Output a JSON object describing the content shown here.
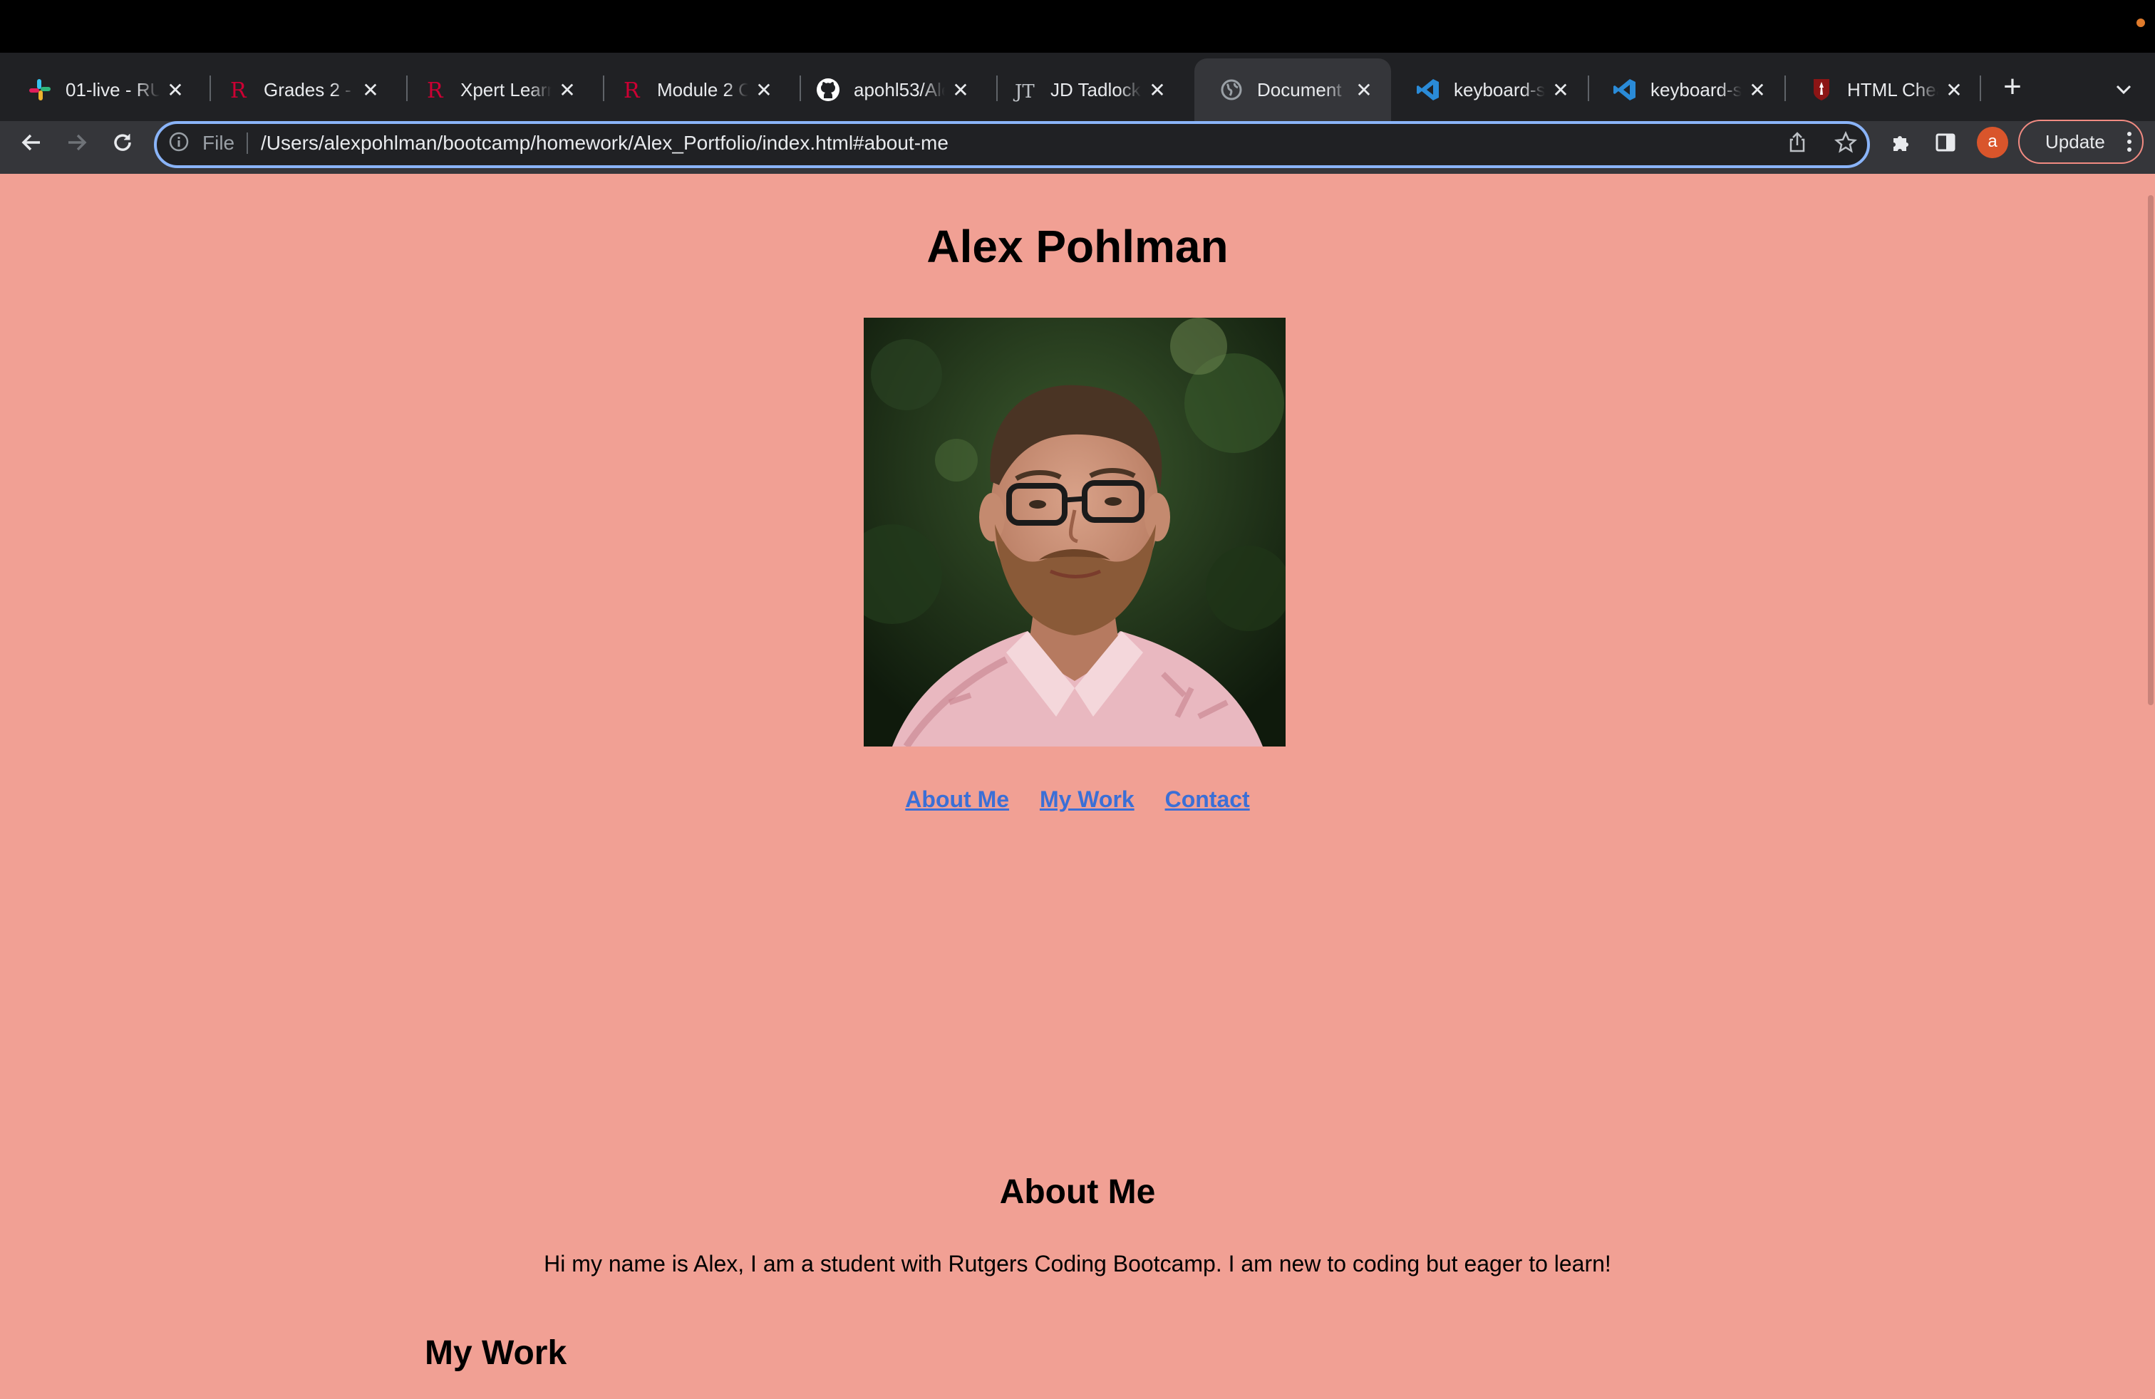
{
  "browser": {
    "tabs": [
      {
        "title": "01-live - RUT",
        "icon": "slack-icon",
        "active": false
      },
      {
        "title": "Grades 2 - B",
        "icon": "rutgers-icon",
        "active": false
      },
      {
        "title": "Xpert Learnin",
        "icon": "rutgers-icon",
        "active": false
      },
      {
        "title": "Module 2 Ch",
        "icon": "rutgers-icon",
        "active": false
      },
      {
        "title": "apohl53/Alex",
        "icon": "github-icon",
        "active": false
      },
      {
        "title": "JD Tadlock | ",
        "icon": "jt-icon",
        "active": false
      },
      {
        "title": "Document",
        "icon": "globe-icon",
        "active": true
      },
      {
        "title": "keyboard-sh",
        "icon": "vscode-icon",
        "active": false
      },
      {
        "title": "keyboard-sh",
        "icon": "vscode-icon",
        "active": false
      },
      {
        "title": "HTML Cheat",
        "icon": "stanford-icon",
        "active": false
      }
    ],
    "address": {
      "scheme_label": "File",
      "url": "/Users/alexpohlman/bootcamp/homework/Alex_Portfolio/index.html#about-me"
    },
    "avatar_letter": "a",
    "update_label": "Update",
    "colors": {
      "tabstrip_bg": "#202124",
      "toolbar_bg": "#35363a",
      "focus_ring": "#8ab4f8",
      "page_bg": "#f1a094",
      "link": "#3b6fd6"
    }
  },
  "page": {
    "title": "Alex Pohlman",
    "nav": [
      "About Me",
      "My Work",
      "Contact"
    ],
    "about": {
      "heading": "About Me",
      "text": "Hi my name is Alex, I am a student with Rutgers Coding Bootcamp. I am new to coding but eager to learn!"
    },
    "work": {
      "heading": "My Work"
    }
  }
}
